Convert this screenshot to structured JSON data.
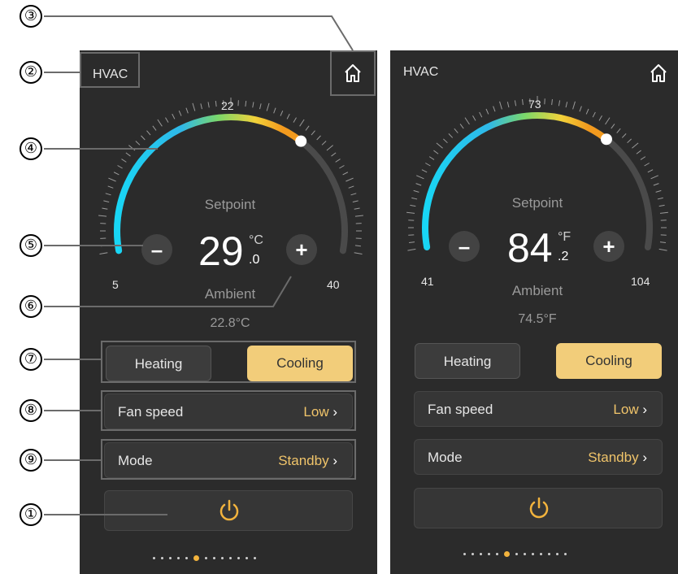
{
  "left": {
    "title": "HVAC",
    "scale_min": "5",
    "scale_mid": "22",
    "scale_max": "40",
    "setpoint_label": "Setpoint",
    "setpoint_int": "29",
    "setpoint_unit": "°C",
    "setpoint_dec": ".0",
    "ambient_label": "Ambient",
    "ambient_value": "22.8°C",
    "heating_label": "Heating",
    "cooling_label": "Cooling",
    "fan_label": "Fan speed",
    "fan_value": "Low",
    "mode_label": "Mode",
    "mode_value": "Standby",
    "page_count": 13,
    "active_page": 5
  },
  "right": {
    "title": "HVAC",
    "scale_min": "41",
    "scale_mid": "73",
    "scale_max": "104",
    "setpoint_label": "Setpoint",
    "setpoint_int": "84",
    "setpoint_unit": "°F",
    "setpoint_dec": ".2",
    "ambient_label": "Ambient",
    "ambient_value": "74.5°F",
    "heating_label": "Heating",
    "cooling_label": "Cooling",
    "fan_label": "Fan speed",
    "fan_value": "Low",
    "mode_label": "Mode",
    "mode_value": "Standby",
    "page_count": 13,
    "active_page": 5
  },
  "callouts": [
    "①",
    "②",
    "③",
    "④",
    "⑤",
    "⑥",
    "⑦",
    "⑧",
    "⑨"
  ],
  "colors": {
    "accent": "#f2cd7a",
    "value_text": "#f0c46a",
    "panel": "#2b2b2b",
    "active_dot": "#f2b33d"
  }
}
